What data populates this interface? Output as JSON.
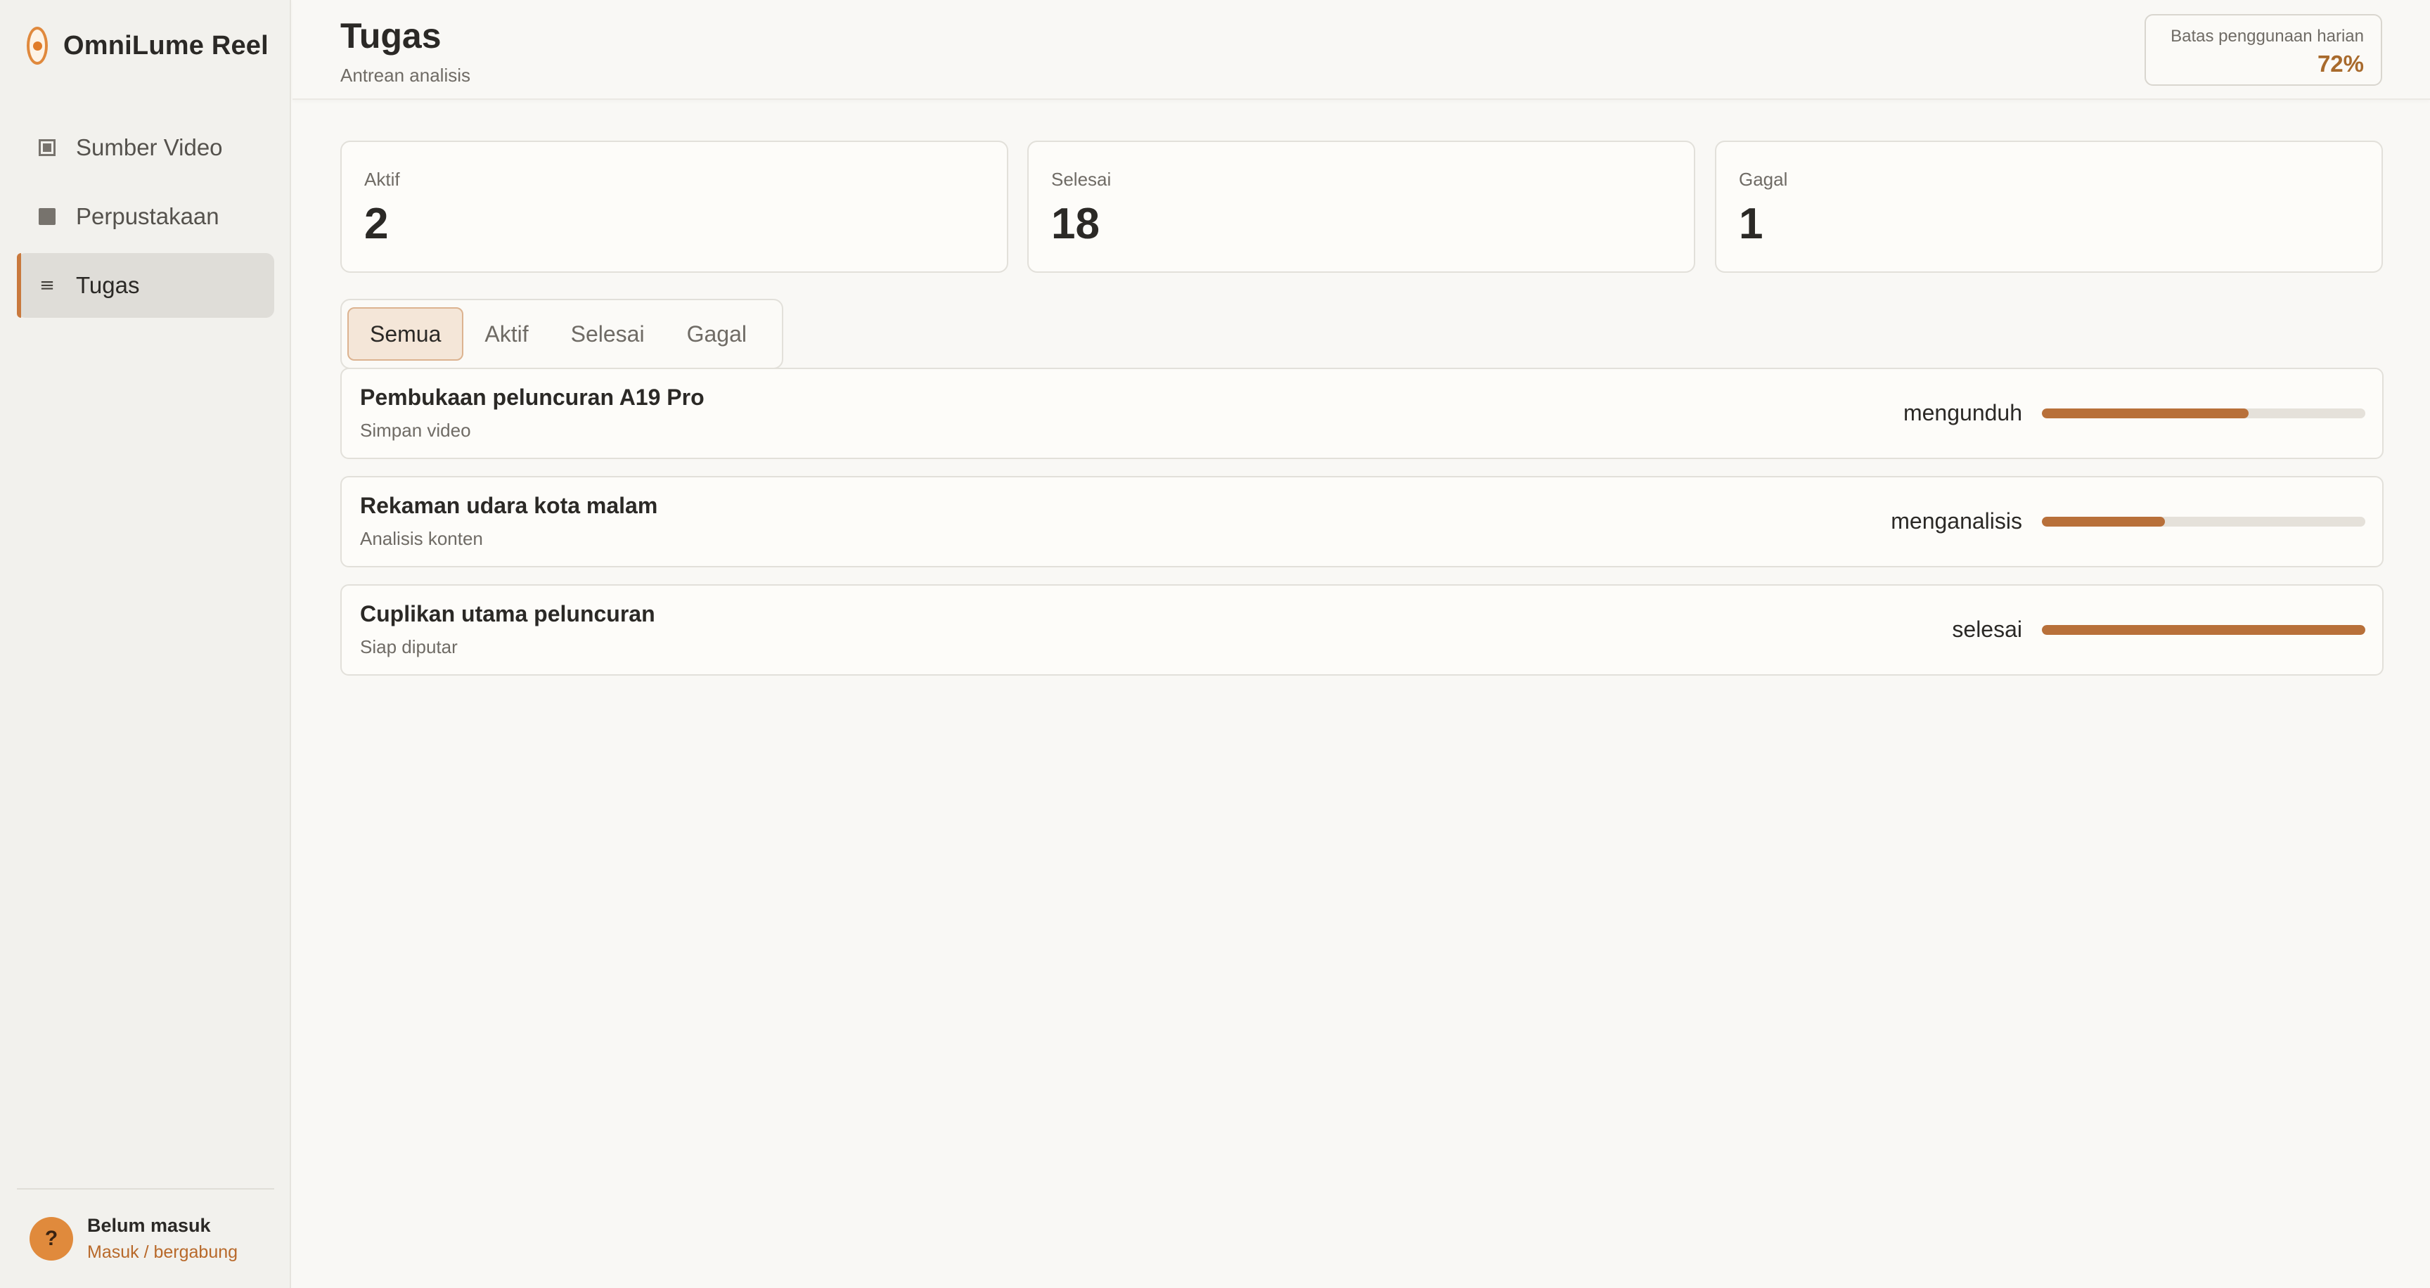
{
  "brand": {
    "name": "OmniLume Reel",
    "logo_icon": "omnilume-logo-icon"
  },
  "sidebar": {
    "items": [
      {
        "label": "Sumber Video",
        "icon": "video-frame-icon",
        "active": false
      },
      {
        "label": "Perpustakaan",
        "icon": "library-square-icon",
        "active": false
      },
      {
        "label": "Tugas",
        "icon": "list-lines-icon",
        "active": true
      }
    ],
    "user": {
      "avatar_text": "?",
      "name": "Belum masuk",
      "link": "Masuk / bergabung"
    }
  },
  "header": {
    "title": "Tugas",
    "subtitle": "Antrean analisis",
    "usage": {
      "label": "Batas penggunaan harian",
      "value": "72%"
    }
  },
  "stats": [
    {
      "label": "Aktif",
      "value": "2"
    },
    {
      "label": "Selesai",
      "value": "18"
    },
    {
      "label": "Gagal",
      "value": "1"
    }
  ],
  "tabs": [
    {
      "label": "Semua",
      "active": true
    },
    {
      "label": "Aktif",
      "active": false
    },
    {
      "label": "Selesai",
      "active": false
    },
    {
      "label": "Gagal",
      "active": false
    }
  ],
  "tasks": [
    {
      "title": "Pembukaan peluncuran A19 Pro",
      "subtitle": "Simpan video",
      "status": "mengunduh",
      "progress": 0.64
    },
    {
      "title": "Rekaman udara kota malam",
      "subtitle": "Analisis konten",
      "status": "menganalisis",
      "progress": 0.38
    },
    {
      "title": "Cuplikan utama peluncuran",
      "subtitle": "Siap diputar",
      "status": "selesai",
      "progress": 1.0
    }
  ],
  "colors": {
    "accent": "#b8703a",
    "brand_orange": "#e0893d",
    "usage_value": "#a86a2c"
  }
}
